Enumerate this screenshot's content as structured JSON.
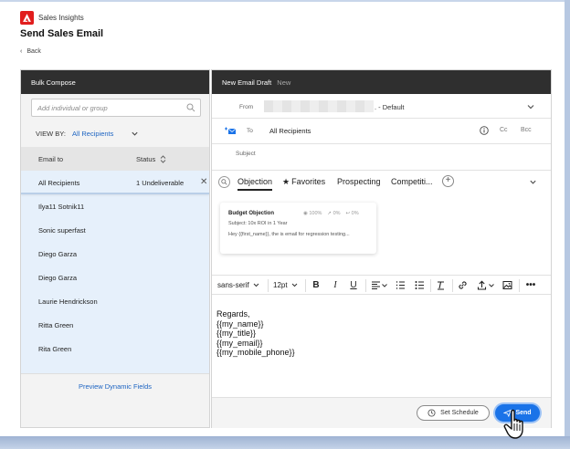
{
  "app": {
    "name": "Sales Insights",
    "title": "Send Sales Email",
    "back_label": "Back"
  },
  "left": {
    "header": "Bulk Compose",
    "search_placeholder": "Add individual or group",
    "view_by_label": "VIEW BY:",
    "view_by_value": "All Recipients",
    "columns": {
      "email_to": "Email to",
      "status": "Status"
    },
    "rows": [
      {
        "name": "All Recipients",
        "status": "1 Undeliverable",
        "selected": true
      },
      {
        "name": "Ilya11 Sotnik11",
        "status": ""
      },
      {
        "name": "Sonic superfast",
        "status": ""
      },
      {
        "name": "Diego Garza",
        "status": ""
      },
      {
        "name": "Diego Garza",
        "status": ""
      },
      {
        "name": "Laurie Hendrickson",
        "status": ""
      },
      {
        "name": "Ritta Green",
        "status": ""
      },
      {
        "name": "Rita Green",
        "status": ""
      }
    ],
    "preview_link": "Preview Dynamic Fields"
  },
  "right": {
    "header": "New Email Draft",
    "header_tag": "New",
    "from_label": "From",
    "from_value": ". - Default",
    "to_label": "To",
    "to_value": "All Recipients",
    "cc_label": "Cc",
    "bcc_label": "Bcc",
    "subject_label": "Subject",
    "tabs": [
      "Objection",
      "Favorites",
      "Prospecting",
      "Competiti..."
    ],
    "active_tab": 0,
    "template": {
      "title": "Budget Objection",
      "stat_open": "100%",
      "stat_click": "0%",
      "stat_reply": "0%",
      "subject": "Subject: 10x ROI in 1 Year",
      "body": "Hey {{first_name}}, the is email for regression testing..."
    },
    "toolbar": {
      "font": "sans-serif",
      "size": "12pt"
    },
    "body_lines": [
      "Regards,",
      "{{my_name}}",
      "{{my_title}}",
      "{{my_email}}",
      "{{my_mobile_phone}}"
    ],
    "schedule_label": "Set Schedule",
    "send_label": "Send"
  },
  "colors": {
    "accent": "#1a73e8",
    "header_bg": "#2f2f2f",
    "brand": "#e11d1d",
    "selected_row": "#e6f0fb"
  }
}
